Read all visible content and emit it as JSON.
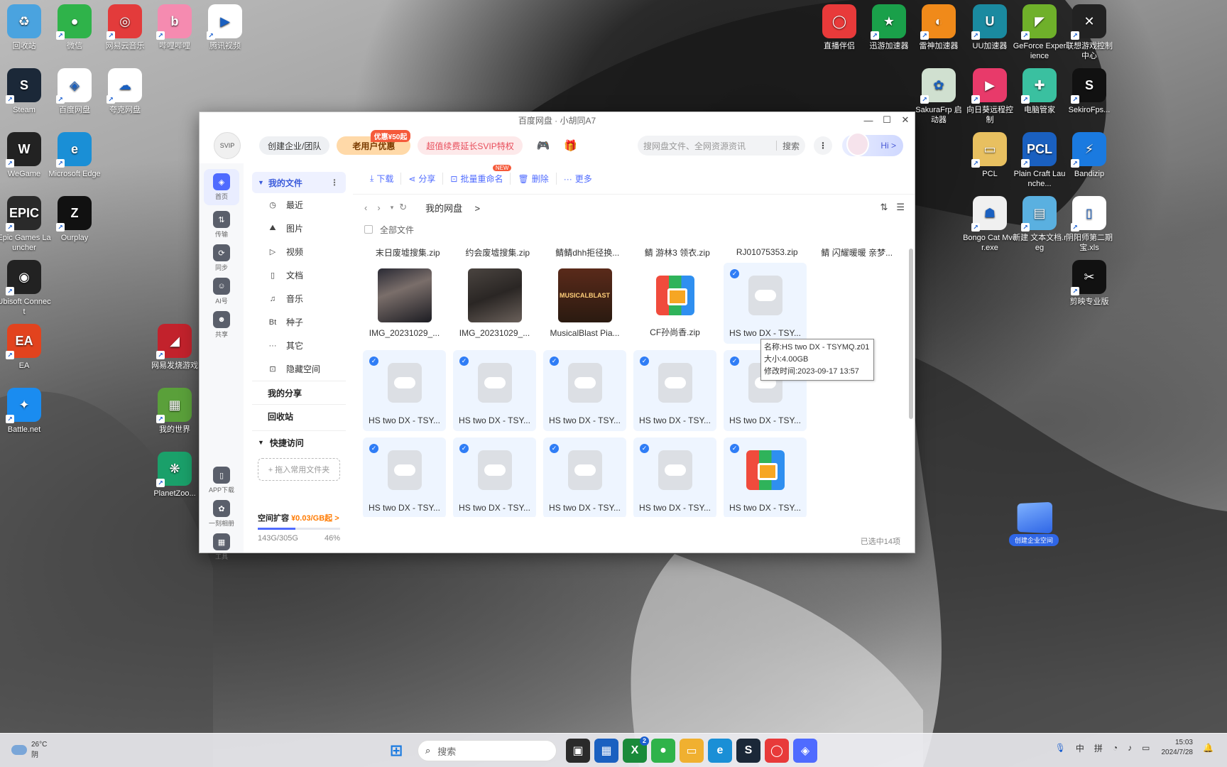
{
  "desktop": {
    "left_icons": [
      {
        "label": "回收站",
        "glyph": "♻",
        "color": "#4aa3df"
      },
      {
        "label": "微信",
        "glyph": "●",
        "color": "#2fb34a"
      },
      {
        "label": "网易云音乐",
        "glyph": "◎",
        "color": "#e33b3b"
      },
      {
        "label": "哔哩哔哩",
        "glyph": "b",
        "color": "#f58bb0"
      },
      {
        "label": "腾讯视频",
        "glyph": "▶",
        "color": "#ffffff"
      },
      {
        "label": "Steam",
        "glyph": "S",
        "color": "#1b2838"
      },
      {
        "label": "百度网盘",
        "glyph": "◈",
        "color": "#ffffff"
      },
      {
        "label": "夸克网盘",
        "glyph": "☁",
        "color": "#ffffff"
      },
      {
        "label": "WeGame",
        "glyph": "W",
        "color": "#222222"
      },
      {
        "label": "Microsoft Edge",
        "glyph": "e",
        "color": "#1a8fd6"
      },
      {
        "label": "Epic Games Launcher",
        "glyph": "EPIC",
        "color": "#2a2a2a"
      },
      {
        "label": "Ourplay",
        "glyph": "Z",
        "color": "#111111"
      },
      {
        "label": "Ubisoft Connect",
        "glyph": "◉",
        "color": "#222222"
      },
      {
        "label": "网易发烧游戏",
        "glyph": "◢",
        "color": "#c2222c"
      },
      {
        "label": "EA",
        "glyph": "EA",
        "color": "#e2431e"
      },
      {
        "label": "我的世界",
        "glyph": "▦",
        "color": "#5aa03a"
      },
      {
        "label": "Battle.net",
        "glyph": "✦",
        "color": "#1a8cf0"
      },
      {
        "label": "PlanetZoo...",
        "glyph": "❋",
        "color": "#1aa06a"
      }
    ],
    "right_icons": [
      {
        "label": "直播伴侣",
        "glyph": "◯",
        "color": "#e83a3a"
      },
      {
        "label": "迅游加速器",
        "glyph": "★",
        "color": "#1aa04a"
      },
      {
        "label": "雷神加速器",
        "glyph": "◐",
        "color": "#f08a1a"
      },
      {
        "label": "UU加速器",
        "glyph": "U",
        "color": "#1a8aa0"
      },
      {
        "label": "GeForce Experience",
        "glyph": "◤",
        "color": "#6fb02a"
      },
      {
        "label": "联想游戏控制中心",
        "glyph": "✕",
        "color": "#222222"
      },
      {
        "label": "SakuraFrp 启动器",
        "glyph": "✿",
        "color": "#d0e0d0"
      },
      {
        "label": "向日葵远程控制",
        "glyph": "▶",
        "color": "#e83a6a"
      },
      {
        "label": "电脑管家",
        "glyph": "✚",
        "color": "#3ac0a0"
      },
      {
        "label": "SekiroFps...",
        "glyph": "S",
        "color": "#111111"
      },
      {
        "label": "PCL",
        "glyph": "▭",
        "color": "#e8c060"
      },
      {
        "label": "Plain Craft Launche...",
        "glyph": "PCL",
        "color": "#1a60c0"
      },
      {
        "label": "Bandizip",
        "glyph": "⚡",
        "color": "#1a7ae0"
      },
      {
        "label": "Bongo Cat Mver.exe",
        "glyph": "☗",
        "color": "#f0f0f0"
      },
      {
        "label": "新建 文本文档.reg",
        "glyph": "▤",
        "color": "#5ab0e0"
      },
      {
        "label": "阴阳师第二期宝.xls",
        "glyph": "▯",
        "color": "#ffffff"
      },
      {
        "label": "剪映专业版",
        "glyph": "✂",
        "color": "#111111"
      }
    ]
  },
  "window": {
    "title": "百度网盘 · 小胡同A7",
    "logo_text": "SVIP",
    "create_team": "创建企业/团队",
    "promo_label": "老用户优惠",
    "promo_badge": "优惠¥50起",
    "svip_label": "超值续费延长SVIP特权",
    "search_placeholder": "搜网盘文件、全网资源资讯",
    "search_button": "搜索",
    "hi_label": "Hi >",
    "controls": {
      "minimize": "—",
      "maximize": "☐",
      "close": "✕"
    }
  },
  "leftnav": [
    {
      "label": "首页",
      "glyph": "◈",
      "active": true
    },
    {
      "label": "传输",
      "glyph": "⇅",
      "active": false
    },
    {
      "label": "同步",
      "glyph": "⟳",
      "active": false
    },
    {
      "label": "AI号",
      "glyph": "☺",
      "active": false
    },
    {
      "label": "共享",
      "glyph": "☻",
      "active": false
    },
    {
      "label": "APP下载",
      "glyph": "▯",
      "active": false
    },
    {
      "label": "一刻相册",
      "glyph": "✿",
      "active": false
    },
    {
      "label": "工具",
      "glyph": "▦",
      "active": false
    }
  ],
  "sidebar": {
    "my_files": "我的文件",
    "items": [
      {
        "icon": "◷",
        "label": "最近"
      },
      {
        "icon": "⛰",
        "label": "图片"
      },
      {
        "icon": "▷",
        "label": "视频"
      },
      {
        "icon": "▯",
        "label": "文档"
      },
      {
        "icon": "♫",
        "label": "音乐"
      },
      {
        "icon": "Bt",
        "label": "种子"
      },
      {
        "icon": "···",
        "label": "其它"
      },
      {
        "icon": "⊡",
        "label": "隐藏空间"
      }
    ],
    "my_share": "我的分享",
    "recycle": "回收站",
    "quick_access": "快捷访问",
    "add_folder": "+ 拖入常用文件夹",
    "quota_title": "空间扩容",
    "quota_price": "¥0.03/GB起 >",
    "quota_used": "143G/305G",
    "quota_percent": "46%",
    "quota_fraction": 0.46
  },
  "toolbar": {
    "download": "下载",
    "share": "分享",
    "rename": "批量重命名",
    "rename_tag": "NEW",
    "delete": "删除",
    "more": "更多"
  },
  "nav": {
    "back": "‹",
    "forward": "›",
    "dropdown": "▾",
    "refresh": "↻",
    "crumb": "我的网盘",
    "crumb_sep": ">",
    "sort_icon": "⇅",
    "view_icon": "☰"
  },
  "select_all": "全部文件",
  "top_names": [
    "末日废墟搜集.zip",
    "约会废墟搜集.zip",
    "鲭鲭dhh拒径换...",
    "鲭 游林3 领衣.zip",
    "RJ01075353.zip",
    "鲭 闪耀暖暖 亲梦..."
  ],
  "files": [
    {
      "name": "IMG_20231029_...",
      "type": "photo1",
      "selected": false,
      "thumb_text": ""
    },
    {
      "name": "IMG_20231029_...",
      "type": "photo2",
      "selected": false,
      "thumb_text": ""
    },
    {
      "name": "MusicalBlast Pia...",
      "type": "album",
      "selected": false,
      "thumb_text": "MUSICALBLAST"
    },
    {
      "name": "CF孙尚香.zip",
      "type": "zip",
      "selected": false,
      "thumb_text": ""
    },
    {
      "name": "HS two DX - TSY...",
      "type": "cloud",
      "selected": true,
      "thumb_text": ""
    },
    {
      "name": "HS two DX - TSY...",
      "type": "cloud",
      "selected": true,
      "thumb_text": ""
    },
    {
      "name": "HS two DX - TSY...",
      "type": "cloud",
      "selected": true,
      "thumb_text": ""
    },
    {
      "name": "HS two DX - TSY...",
      "type": "cloud",
      "selected": true,
      "thumb_text": ""
    },
    {
      "name": "HS two DX - TSY...",
      "type": "cloud",
      "selected": true,
      "thumb_text": ""
    },
    {
      "name": "HS two DX - TSY...",
      "type": "cloud",
      "selected": true,
      "thumb_text": ""
    },
    {
      "name": "HS two DX - TSY...",
      "type": "cloud",
      "selected": true,
      "thumb_text": ""
    },
    {
      "name": "HS two DX - TSY...",
      "type": "cloud",
      "selected": true,
      "thumb_text": ""
    },
    {
      "name": "HS two DX - TSY...",
      "type": "cloud",
      "selected": true,
      "thumb_text": ""
    },
    {
      "name": "HS two DX - TSY...",
      "type": "cloud",
      "selected": true,
      "thumb_text": ""
    },
    {
      "name": "HS two DX - TSY...",
      "type": "zip",
      "selected": true,
      "thumb_text": ""
    },
    {
      "name": "HS two DX - TSY...",
      "type": "cloud",
      "selected": true,
      "thumb_text": ""
    },
    {
      "name": "HS two DX - TSY...",
      "type": "cloud",
      "selected": true,
      "thumb_text": ""
    },
    {
      "name": "HS two DX - TSY...",
      "type": "cloud",
      "selected": true,
      "thumb_text": ""
    }
  ],
  "tooltip": {
    "name": "名称:HS two DX - TSYMQ.z01",
    "size": "大小:4.00GB",
    "modified": "修改时间:2023-09-17 13:57"
  },
  "float_badge": "创建企业空间",
  "status": "已选中14项",
  "taskbar": {
    "weather_temp": "26°C",
    "weather_desc": "阴",
    "search_placeholder": "搜索",
    "apps": [
      {
        "glyph": "▣",
        "color": "#2a2a2a"
      },
      {
        "glyph": "▦",
        "color": "#1a60c0"
      },
      {
        "glyph": "X",
        "color": "#1a8a3a"
      },
      {
        "glyph": "●",
        "color": "#2fb34a"
      },
      {
        "glyph": "▭",
        "color": "#f0b030"
      },
      {
        "glyph": "e",
        "color": "#1a8fd6"
      },
      {
        "glyph": "S",
        "color": "#1b2838"
      },
      {
        "glyph": "◯",
        "color": "#e83a3a"
      },
      {
        "glyph": "◈",
        "color": "#4f6bff"
      }
    ],
    "xbox_badge": "2",
    "tray_lang": "中",
    "tray_ime": "拼",
    "time": "15:03",
    "date": "2024/7/28"
  }
}
